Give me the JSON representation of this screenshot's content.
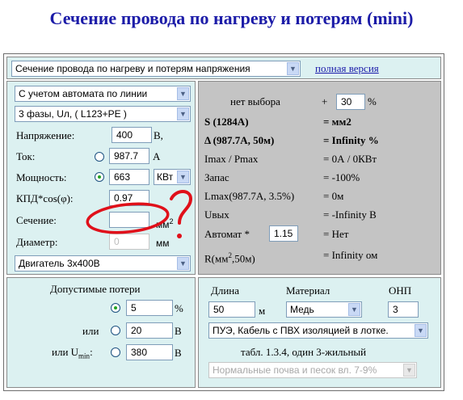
{
  "title": "Сечение провода по нагреву и потерям (mini)",
  "top": {
    "mode_select": "Сечение провода по нагреву и потерям напряжения",
    "full_version_link": "полная версия"
  },
  "left": {
    "breaker_select": "С учетом автомата по линии",
    "phase_select": "3 фазы, Uл,  ( L123+PE )",
    "voltage": {
      "label": "Напряжение:",
      "value": "400",
      "unit": "В,"
    },
    "current": {
      "label": "Ток:",
      "value": "987.7",
      "unit": "А"
    },
    "power": {
      "label": "Мощность:",
      "value": "663",
      "unit_select": "КВт"
    },
    "efficiency": {
      "label": "КПД*cos(φ):",
      "value": "0.97"
    },
    "section": {
      "label": "Сечение:",
      "value": "",
      "unit_base": "мм",
      "unit_sup": "2"
    },
    "diameter": {
      "label": "Диаметр:",
      "value": "0",
      "unit": "мм"
    },
    "load_select": "Двигатель 3x400В"
  },
  "results": {
    "no_choice": "нет выбора",
    "plus": "+",
    "margin_value": "30",
    "percent": "%",
    "rows": [
      {
        "left": "S (1284А)",
        "right": "= мм2",
        "bold": true
      },
      {
        "left": "Δ (987.7А, 50м)",
        "right": "= Infinity %",
        "bold": true
      },
      {
        "left": "Imax / Pmax",
        "right": "= 0А / 0КВт",
        "bold": false
      },
      {
        "left": "Запас",
        "right": "= -100%",
        "bold": false
      },
      {
        "left": "Lmax(987.7А, 3.5%)",
        "right": "= 0м",
        "bold": false
      },
      {
        "left": "Uвых",
        "right": "= -Infinity В",
        "bold": false
      }
    ],
    "breaker": {
      "label": "Автомат *",
      "value": "1.15",
      "result": "= Нет"
    },
    "resistance": {
      "label_base": "R(мм",
      "label_sup": "2",
      "label_tail": ",50м)",
      "result": "= Infinity ом"
    }
  },
  "losses": {
    "heading": "Допустимые потери",
    "row1": {
      "value": "5",
      "unit": "%"
    },
    "row2": {
      "label": "или",
      "value": "20",
      "unit": "В"
    },
    "row3": {
      "label_base": "или U",
      "label_sub": "min",
      "label_colon": ":",
      "value": "380",
      "unit": "В"
    }
  },
  "line": {
    "length_label": "Длина",
    "length_value": "50",
    "length_unit": "м",
    "material_label": "Материал",
    "material_select": "Медь",
    "onp_label": "ОНП",
    "onp_value": "3",
    "cable_select": "ПУЭ, Кабель с ПВХ изоляцией в лотке.",
    "table_note": "табл. 1.3.4, один 3-жильный",
    "soil_select": "Нормальные почва и песок вл. 7-9%"
  },
  "colors": {
    "title": "#1c1ca8",
    "panel_bg": "#dcf1f1",
    "results_bg": "#c4c4c4",
    "annotation_red": "#e0101a"
  }
}
